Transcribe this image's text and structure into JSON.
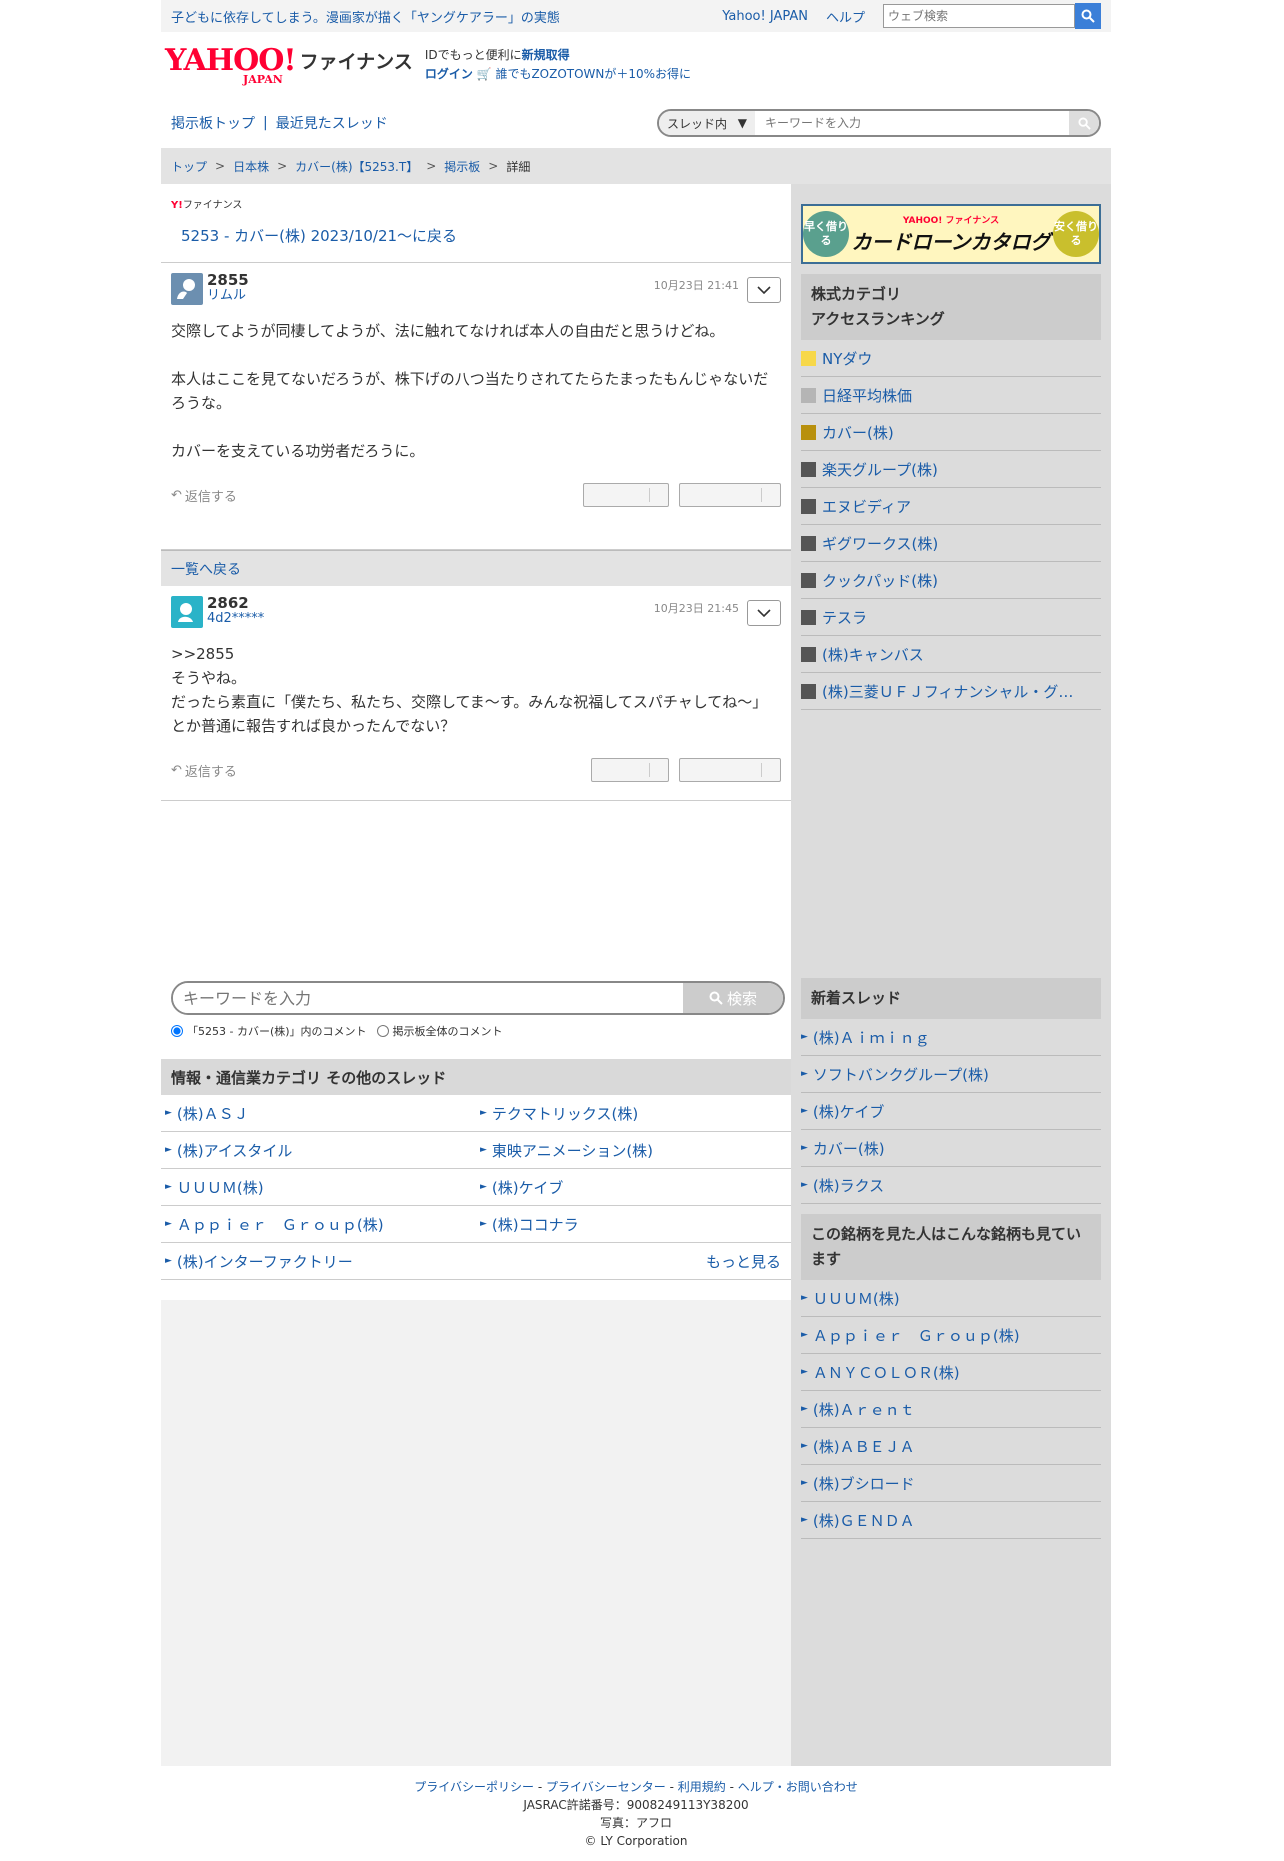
{
  "topbar": {
    "promo": "子どもに依存してしまう。漫画家が描く「ヤングケアラー」の実態",
    "yahoo_japan": "Yahoo! JAPAN",
    "help": "ヘルプ",
    "web_search_placeholder": "ウェブ検索"
  },
  "header": {
    "logo_yahoo": "YAHOO!",
    "logo_japan": "JAPAN",
    "logo_finance": "ファイナンス",
    "id_line_prefix": "IDでもっと便利に",
    "id_line_link": "新規取得",
    "login": "ログイン",
    "zozo": "誰でもZOZOTOWNが＋10%お得に"
  },
  "subnav": {
    "board_top": "掲示板トップ",
    "separator": "|",
    "recent": "最近見たスレッド",
    "scope": "スレッド内",
    "keyword_placeholder": "キーワードを入力"
  },
  "breadcrumb": [
    "トップ",
    "日本株",
    "カバー(株)【5253.T】",
    "掲示板",
    "詳細"
  ],
  "thread": {
    "finance_mini_y": "Y!",
    "finance_mini_label": "ファイナンス",
    "back_link": "5253 - カバー(株) 2023/10/21〜に戻る"
  },
  "posts": [
    {
      "number": "2855",
      "user": "リムル",
      "date": "10月23日 21:41",
      "avatar_color": "#6c8fb0",
      "lines": [
        "交際してようが同棲してようが、法に触れてなければ本人の自由だと思うけどね。",
        "",
        "本人はここを見てないだろうが、株下げの八つ当たりされてたらたまったもんじゃないだろうな。",
        "",
        "カバーを支えている功労者だろうに。"
      ],
      "reply": "返信する"
    },
    {
      "number": "2862",
      "user": "4d2*****",
      "date": "10月23日 21:45",
      "avatar_color": "#2ab3c8",
      "lines": [
        ">>2855",
        "そうやね。",
        "だったら素直に「僕たち、私たち、交際してま〜す。みんな祝福してスパチャしてね〜」",
        "とか普通に報告すれば良かったんでない？"
      ],
      "reply": "返信する"
    }
  ],
  "list_back": "一覧へ戻る",
  "keyword_search": {
    "placeholder": "キーワードを入力",
    "button": "検索",
    "option_thread": "「5253 - カバー(株)」内のコメント",
    "option_all": "掲示板全体のコメント"
  },
  "other_threads": {
    "title": "情報・通信業カテゴリ その他のスレッド",
    "items": [
      "(株)ＡＳＪ",
      "テクマトリックス(株)",
      "(株)アイスタイル",
      "東映アニメーション(株)",
      "ＵＵＵＭ(株)",
      "(株)ケイブ",
      "Ａｐｐｉｅｒ　Ｇｒｏｕｐ(株)",
      "(株)ココナラ",
      "(株)インターファクトリー"
    ],
    "more": "もっと見る"
  },
  "ad": {
    "left": "早く借りる",
    "brand": "YAHOO! ファイナンス",
    "title": "カードローンカタログ",
    "right": "安く借りる"
  },
  "ranking": {
    "title_line1": "株式カテゴリ",
    "title_line2": "アクセスランキング",
    "items": [
      {
        "name": "NYダウ",
        "color": "#f7d84a"
      },
      {
        "name": "日経平均株価",
        "color": "#b5b5b5"
      },
      {
        "name": "カバー(株)",
        "color": "#b8900d"
      },
      {
        "name": "楽天グループ(株)",
        "color": "#555555"
      },
      {
        "name": "エヌビディア",
        "color": "#555555"
      },
      {
        "name": "ギグワークス(株)",
        "color": "#555555"
      },
      {
        "name": "クックパッド(株)",
        "color": "#555555"
      },
      {
        "name": "テスラ",
        "color": "#555555"
      },
      {
        "name": "(株)キャンバス",
        "color": "#555555"
      },
      {
        "name": "(株)三菱ＵＦＪフィナンシャル・グ…",
        "color": "#555555"
      }
    ]
  },
  "new_threads": {
    "title": "新着スレッド",
    "items": [
      "(株)Ａｉｍｉｎｇ",
      "ソフトバンクグループ(株)",
      "(株)ケイブ",
      "カバー(株)",
      "(株)ラクス"
    ]
  },
  "also_viewed": {
    "title": "この銘柄を見た人はこんな銘柄も見ています",
    "items": [
      "ＵＵＵＭ(株)",
      "Ａｐｐｉｅｒ　Ｇｒｏｕｐ(株)",
      "ＡＮＹＣＯＬＯＲ(株)",
      "(株)Ａｒｅｎｔ",
      "(株)ＡＢＥＪＡ",
      "(株)ブシロード",
      "(株)ＧＥＮＤＡ"
    ]
  },
  "footer": {
    "links": [
      "プライバシーポリシー",
      "プライバシーセンター",
      "利用規約",
      "ヘルプ・お問い合わせ"
    ],
    "jasrac": "JASRAC許諾番号：9008249113Y38200",
    "photo": "写真：アフロ",
    "copyright": "© LY Corporation"
  }
}
